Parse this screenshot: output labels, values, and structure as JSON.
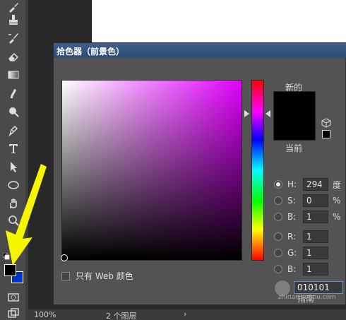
{
  "window": {
    "title": "拾色器（前景色）"
  },
  "picker": {
    "hue_deg": 294,
    "label_new": "新的",
    "label_current": "当前",
    "new_color": "#000000",
    "current_color": "#000000",
    "fields": [
      {
        "label": "H:",
        "value": "294",
        "unit": "度",
        "selected": true,
        "radio": true
      },
      {
        "label": "S:",
        "value": "0",
        "unit": "%",
        "selected": false,
        "radio": true
      },
      {
        "label": "B:",
        "value": "1",
        "unit": "%",
        "selected": false,
        "radio": true
      },
      {
        "label": "R:",
        "value": "1",
        "unit": "",
        "selected": false,
        "radio": true
      },
      {
        "label": "G:",
        "value": "1",
        "unit": "",
        "selected": false,
        "radio": true
      },
      {
        "label": "B:",
        "value": "1",
        "unit": "",
        "selected": false,
        "radio": true
      }
    ],
    "web_only_label": "只有 Web 颜色",
    "hex_partial": "010101",
    "watermark_text": "zhinan.sogou.com",
    "watermark_overlay": "指南"
  },
  "status": {
    "zoom": "100%",
    "layers": "2 个图层",
    "arrow": "›"
  },
  "toolbar": {
    "foreground_color": "#000000",
    "background_color": "#0033cc",
    "tools": [
      "brush-icon",
      "stamp-icon",
      "history-brush-icon",
      "eraser-icon",
      "gradient-icon",
      "smudge-icon",
      "dodge-icon",
      "pen-icon",
      "type-icon",
      "path-select-icon",
      "ellipse-icon",
      "hand-icon",
      "zoom-icon",
      "dots-icon"
    ]
  },
  "colors": {
    "accent_arrow": "#f5f500",
    "title_bar": "#34517f"
  }
}
